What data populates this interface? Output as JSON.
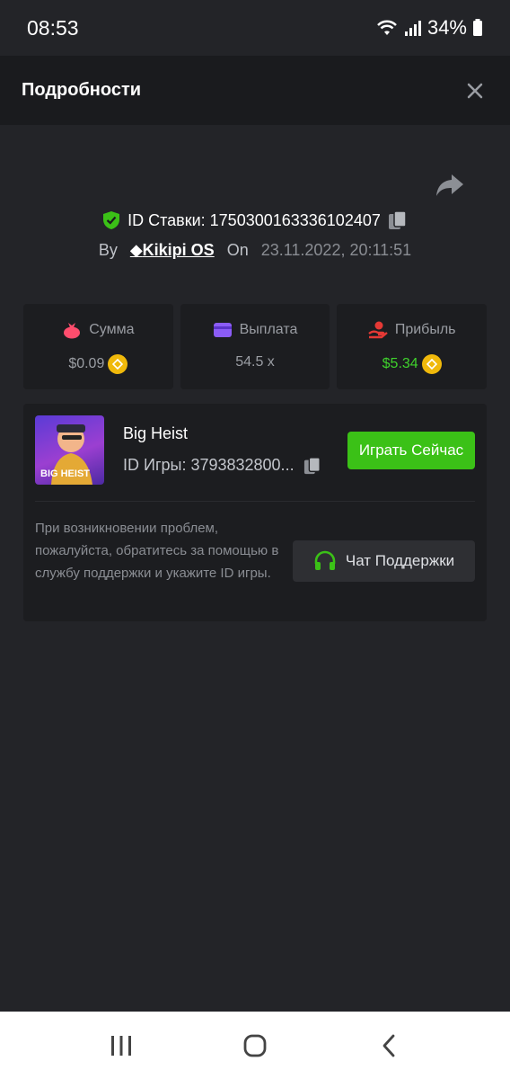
{
  "status_bar": {
    "time": "08:53",
    "battery": "34%"
  },
  "header": {
    "title": "Подробности"
  },
  "bet": {
    "id_label": "ID Ставки: 1750300163336102407",
    "by_label": "By",
    "user": "Kikipi OS",
    "on_label": "On",
    "date": "23.11.2022, 20:11:51"
  },
  "stats": [
    {
      "label": "Сумма",
      "value": "$0.09"
    },
    {
      "label": "Выплата",
      "value": "54.5 x"
    },
    {
      "label": "Прибыль",
      "value": "$5.34"
    }
  ],
  "game": {
    "title": "Big Heist",
    "id_label": "ID Игры: 3793832800...",
    "thumb_text": "BIG HEIST",
    "play_label": "Играть Сейчас"
  },
  "help": {
    "text": "При возникновении проблем, пожалуйста, обратитесь за помощью в службу поддержки и укажите ID игры.",
    "support_label": "Чат Поддержки"
  },
  "colors": {
    "accent_green": "#3bc117",
    "profit_green": "#3fd12c",
    "coin": "#f0b90b"
  },
  "icons": [
    "shield-check-icon",
    "copy-icon",
    "share-icon",
    "close-icon",
    "money-bag-icon",
    "wallet-icon",
    "profit-hand-icon",
    "coin-icon",
    "headset-icon",
    "recent-apps-icon",
    "home-icon",
    "back-icon"
  ]
}
